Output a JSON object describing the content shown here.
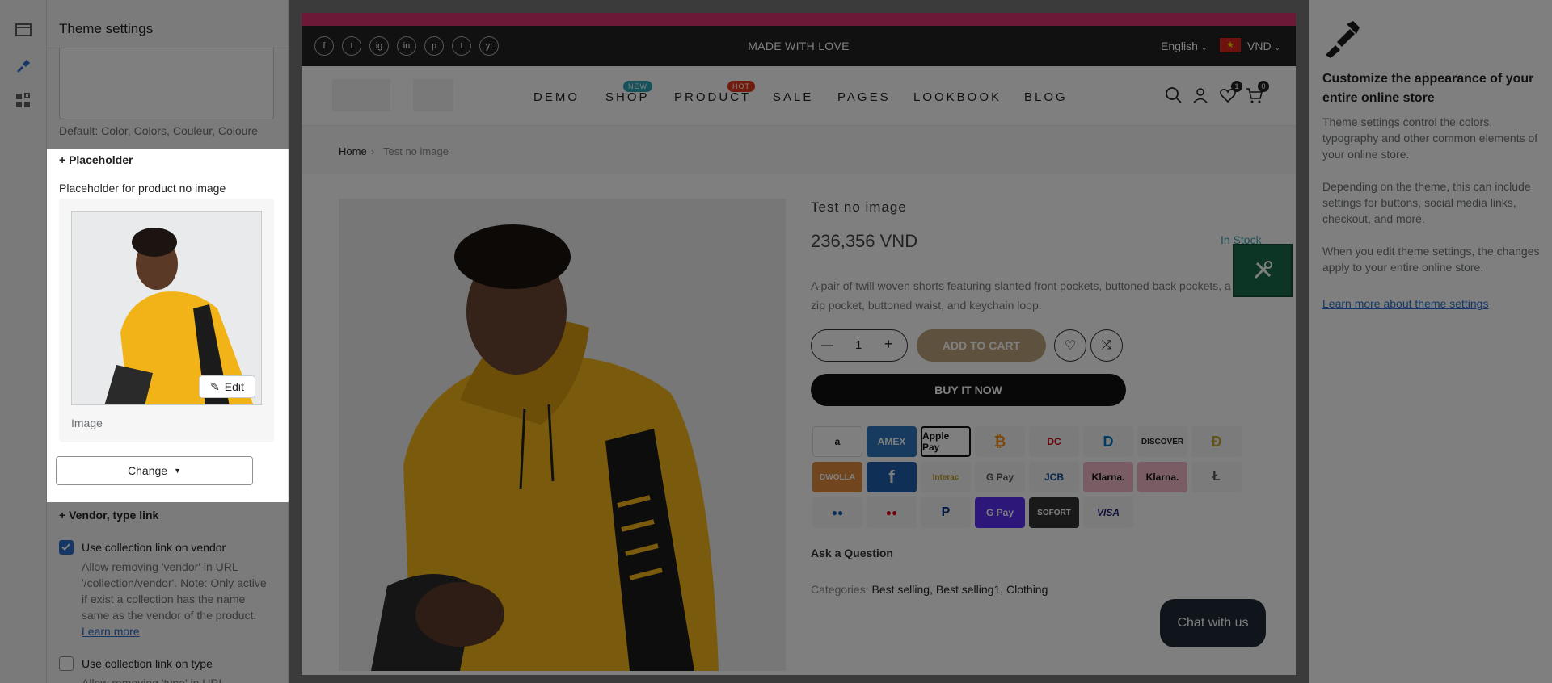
{
  "settings": {
    "title": "Theme settings",
    "default_help": "Default: Color, Colors, Couleur, Coloure",
    "placeholder_section": "+ Placeholder",
    "placeholder_label": "Placeholder for product no image",
    "edit_label": "Edit",
    "image_caption": "Image",
    "change_label": "Change",
    "vendor_section": "+ Vendor, type link",
    "vendor_checkbox": "Use collection link on vendor",
    "vendor_checked": true,
    "vendor_help": "Allow removing 'vendor' in URL '/collection/vendor'. Note: Only active if exist a collection has the name same as the vendor of the product.",
    "learn_more": "Learn more",
    "type_checkbox": "Use collection link on type",
    "type_checked": false,
    "type_help_partial": "Allow removing 'type' in URL"
  },
  "store": {
    "topbar_text": "MADE WITH LOVE",
    "social": [
      "f",
      "t",
      "ig",
      "in",
      "p",
      "t",
      "yt"
    ],
    "language": "English",
    "currency": "VND",
    "nav": [
      {
        "label": "DEMO",
        "badge": ""
      },
      {
        "label": "SHOP",
        "badge": "NEW"
      },
      {
        "label": "PRODUCT",
        "badge": "HOT"
      },
      {
        "label": "SALE",
        "badge": ""
      },
      {
        "label": "PAGES",
        "badge": ""
      },
      {
        "label": "LOOKBOOK",
        "badge": ""
      },
      {
        "label": "BLOG",
        "badge": ""
      }
    ],
    "wishlist_count": "1",
    "cart_count": "0",
    "breadcrumb": {
      "home": "Home",
      "sep": "›",
      "current": "Test no image"
    },
    "product": {
      "name": "Test no image",
      "price": "236,356 VND",
      "stock": "In Stock",
      "description": "A pair of twill woven shorts featuring slanted front pockets, buttoned back pockets, a zip pocket, buttoned waist, and keychain loop.",
      "qty": "1",
      "add_to_cart": "ADD TO CART",
      "buy_now": "BUY IT NOW",
      "ask": "Ask a Question",
      "categories_label": "Categories:",
      "categories": "Best selling, Best selling1, Clothing"
    },
    "payments": [
      "a",
      "AMEX",
      "Apple Pay",
      "₿",
      "DC",
      "D",
      "DISCOVER",
      "Ð",
      "DWOLLA",
      "f",
      "Interac",
      "G Pay",
      "JCB",
      "Klarna.",
      "Klarna.",
      "Ł",
      "●●",
      "●●",
      "P",
      "G Pay",
      "SOFORT",
      "VISA"
    ],
    "chat": "Chat with us"
  },
  "right_panel": {
    "heading": "Customize the appearance of your entire online store",
    "p1": "Theme settings control the colors, typography and other common elements of your online store.",
    "p2": "Depending on the theme, this can include settings for buttons, social media links, checkout, and more.",
    "p3": "When you edit theme settings, the changes apply to your entire online store.",
    "link": "Learn more about theme settings"
  },
  "colors": {
    "accent": "#2c6ecb",
    "pink_bar": "#d6336c",
    "new_badge": "#2aa3b7",
    "hot_badge": "#e2391f",
    "tool_green": "#1a6b4a"
  }
}
